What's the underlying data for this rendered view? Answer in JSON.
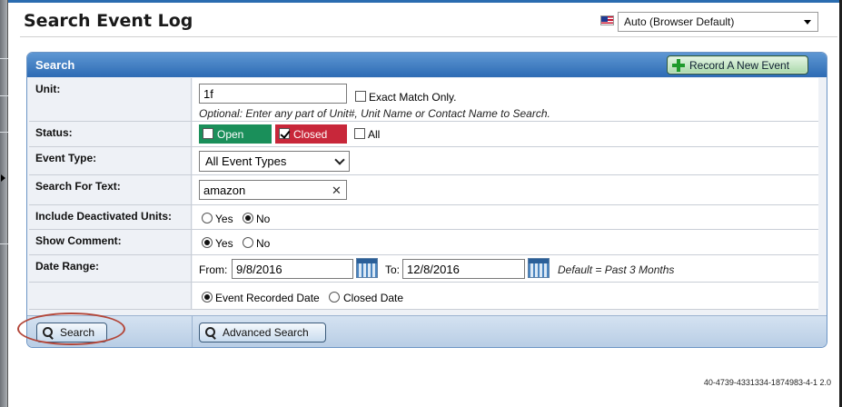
{
  "header": {
    "title": "Search Event Log",
    "language_select": {
      "value": "Auto (Browser Default)"
    }
  },
  "panel": {
    "title": "Search",
    "record_button": "Record A New Event"
  },
  "form": {
    "unit": {
      "label": "Unit:",
      "value": "1f",
      "exact_match_label": "Exact Match Only.",
      "exact_match_checked": false,
      "hint": "Optional: Enter any part of Unit#, Unit Name or Contact Name to Search."
    },
    "status": {
      "label": "Status:",
      "open_label": "Open",
      "open_checked": false,
      "open_color": "#1a8f5a",
      "closed_label": "Closed",
      "closed_checked": true,
      "closed_color": "#c8273a",
      "all_label": "All",
      "all_checked": false
    },
    "event_type": {
      "label": "Event Type:",
      "value": "All Event Types"
    },
    "search_text": {
      "label": "Search For Text:",
      "value": "amazon",
      "clear_glyph": "✕"
    },
    "include_deactivated": {
      "label": "Include Deactivated Units:",
      "yes": "Yes",
      "no": "No",
      "selected": "No"
    },
    "show_comment": {
      "label": "Show Comment:",
      "yes": "Yes",
      "no": "No",
      "selected": "Yes"
    },
    "date_range": {
      "label": "Date Range:",
      "from_label": "From:",
      "from_value": "9/8/2016",
      "to_label": "To:",
      "to_value": "12/8/2016",
      "default_hint": "Default = Past 3 Months",
      "basis_recorded": "Event Recorded Date",
      "basis_closed": "Closed Date",
      "basis_selected": "Event Recorded Date"
    }
  },
  "actions": {
    "search": "Search",
    "advanced_search": "Advanced Search"
  },
  "footer": {
    "build_id": "40-4739-4331334-1874983-4-1 2.0"
  },
  "colors": {
    "header_blue": "#2d6bb4",
    "highlight_ring": "#b3473a"
  }
}
